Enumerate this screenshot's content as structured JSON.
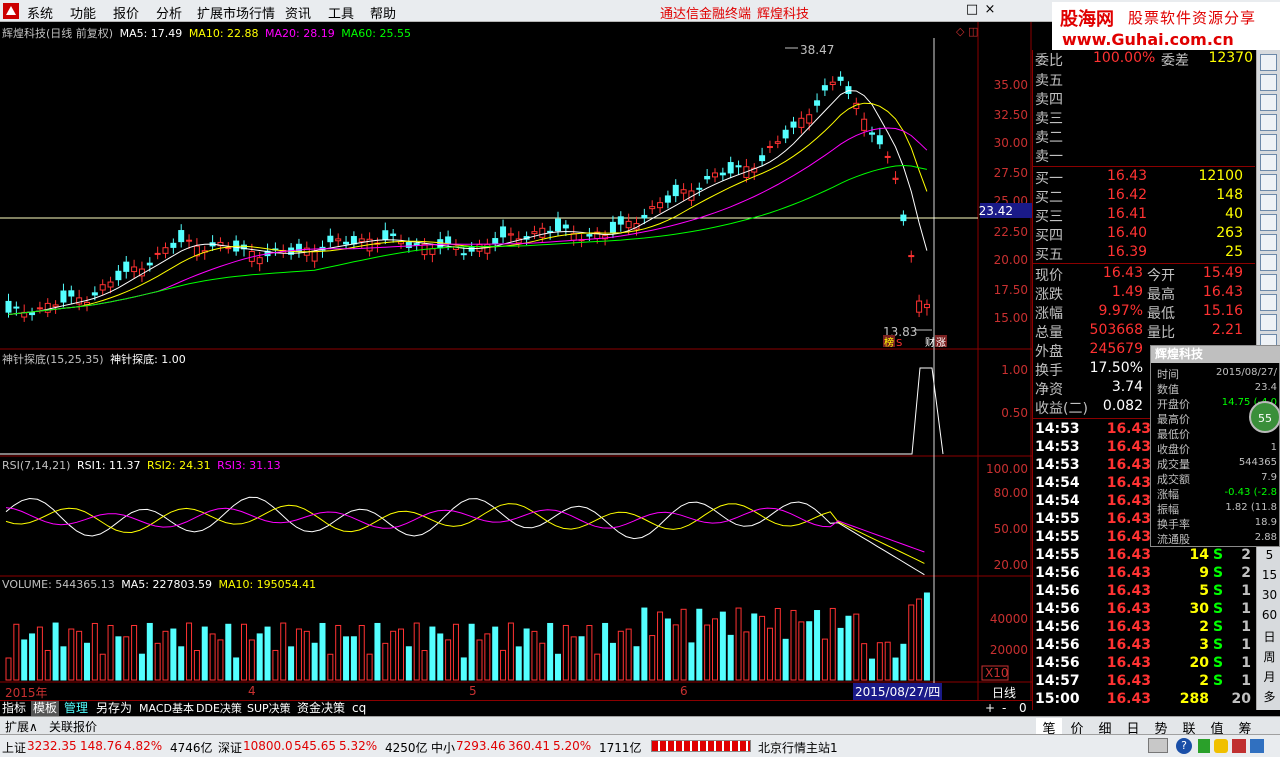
{
  "menu": {
    "items": [
      "系统",
      "功能",
      "报价",
      "分析",
      "扩展市场行情",
      "资讯",
      "工具",
      "帮助"
    ],
    "app_title": "通达信金融终端",
    "stock_title": "辉煌科技",
    "window_buttons": [
      "□",
      "×"
    ]
  },
  "banner": {
    "brand": "股海网",
    "tagline": "股票软件资源分享",
    "url": "www.Guhai.com.cn"
  },
  "main_chart": {
    "legend_title": "辉煌科技(日线 前复权)",
    "ma5": "MA5: 17.49",
    "ma10": "MA10: 22.88",
    "ma20": "MA20: 28.19",
    "ma60": "MA60: 25.55",
    "price_ticks": [
      "35.00",
      "32.50",
      "30.00",
      "27.50",
      "25.00",
      "22.50",
      "20.00",
      "17.50",
      "15.00"
    ],
    "current_price_tag": "23.42",
    "high_label": "38.47",
    "low_label": "13.83",
    "signal_labels": [
      "榜",
      "S",
      "财",
      "涨"
    ]
  },
  "indicator_panel": {
    "legend_name": "神针探底(15,25,35)",
    "legend_value": "神针探底: 1.00",
    "ticks": [
      "1.00",
      "0.50"
    ]
  },
  "rsi_panel": {
    "legend_name": "RSI(7,14,21)",
    "rsi1": "RSI1: 11.37",
    "rsi2": "RSI2: 24.31",
    "rsi3": "RSI3: 31.13",
    "ticks": [
      "100.00",
      "80.00",
      "50.00",
      "20.00"
    ]
  },
  "volume_panel": {
    "legend_volume": "VOLUME: 544365.13",
    "ma5": "MA5: 227803.59",
    "ma10": "MA10: 195054.41",
    "ticks": [
      "40000",
      "20000"
    ],
    "unit": "X10"
  },
  "time_axis": {
    "labels": [
      "2015年",
      "4",
      "5",
      "6"
    ],
    "cursor_date": "2015/08/27/四",
    "period": "日线"
  },
  "quote_panel": {
    "header_left": "委比",
    "header_mid": "100.00%",
    "header_right_label": "委差",
    "header_right_value": "12370",
    "asks": [
      {
        "label": "卖五",
        "price": "",
        "volume": ""
      },
      {
        "label": "卖四",
        "price": "",
        "volume": ""
      },
      {
        "label": "卖三",
        "price": "",
        "volume": ""
      },
      {
        "label": "卖二",
        "price": "",
        "volume": ""
      },
      {
        "label": "卖一",
        "price": "",
        "volume": ""
      }
    ],
    "bids": [
      {
        "label": "买一",
        "price": "16.43",
        "volume": "12100"
      },
      {
        "label": "买二",
        "price": "16.42",
        "volume": "148"
      },
      {
        "label": "买三",
        "price": "16.41",
        "volume": "40"
      },
      {
        "label": "买四",
        "price": "16.40",
        "volume": "263"
      },
      {
        "label": "买五",
        "price": "16.39",
        "volume": "25"
      }
    ],
    "stats": [
      {
        "l1": "现价",
        "v1": "16.43",
        "l2": "今开",
        "v2": "15.49"
      },
      {
        "l1": "涨跌",
        "v1": "1.49",
        "l2": "最高",
        "v2": "16.43"
      },
      {
        "l1": "涨幅",
        "v1": "9.97%",
        "l2": "最低",
        "v2": "15.16"
      },
      {
        "l1": "总量",
        "v1": "503668",
        "l2": "量比",
        "v2": "2.21"
      },
      {
        "l1": "外盘",
        "v1": "245679",
        "l2": "",
        "v2": ""
      },
      {
        "l1": "换手",
        "v1": "17.50%",
        "l2": "",
        "v2": ""
      },
      {
        "l1": "净资",
        "v1": "3.74",
        "l2": "",
        "v2": ""
      },
      {
        "l1": "收益(二)",
        "v1": "0.082",
        "l2": "",
        "v2": ""
      }
    ],
    "ticks": [
      {
        "time": "14:53",
        "price": "16.43",
        "vol": "",
        "bs": "",
        "n": ""
      },
      {
        "time": "14:53",
        "price": "16.43",
        "vol": "",
        "bs": "",
        "n": ""
      },
      {
        "time": "14:53",
        "price": "16.43",
        "vol": "",
        "bs": "",
        "n": ""
      },
      {
        "time": "14:54",
        "price": "16.43",
        "vol": "",
        "bs": "",
        "n": ""
      },
      {
        "time": "14:54",
        "price": "16.43",
        "vol": "",
        "bs": "",
        "n": ""
      },
      {
        "time": "14:55",
        "price": "16.43",
        "vol": "",
        "bs": "",
        "n": ""
      },
      {
        "time": "14:55",
        "price": "16.43",
        "vol": "",
        "bs": "",
        "n": ""
      },
      {
        "time": "14:55",
        "price": "16.43",
        "vol": "14",
        "bs": "S",
        "n": "2"
      },
      {
        "time": "14:56",
        "price": "16.43",
        "vol": "9",
        "bs": "S",
        "n": "2"
      },
      {
        "time": "14:56",
        "price": "16.43",
        "vol": "5",
        "bs": "S",
        "n": "1"
      },
      {
        "time": "14:56",
        "price": "16.43",
        "vol": "30",
        "bs": "S",
        "n": "1"
      },
      {
        "time": "14:56",
        "price": "16.43",
        "vol": "2",
        "bs": "S",
        "n": "1"
      },
      {
        "time": "14:56",
        "price": "16.43",
        "vol": "3",
        "bs": "S",
        "n": "1"
      },
      {
        "time": "14:56",
        "price": "16.43",
        "vol": "20",
        "bs": "S",
        "n": "1"
      },
      {
        "time": "14:57",
        "price": "16.43",
        "vol": "2",
        "bs": "S",
        "n": "1"
      },
      {
        "time": "15:00",
        "price": "16.43",
        "vol": "288",
        "bs": "",
        "n": "20"
      }
    ]
  },
  "popup": {
    "title": "辉煌科技",
    "rows": [
      {
        "label": "时间",
        "value": "2015/08/27/"
      },
      {
        "label": "数值",
        "value": "23.4"
      },
      {
        "label": "开盘价",
        "value": "14.75 (-4.0"
      },
      {
        "label": "最高价",
        "value": ""
      },
      {
        "label": "最低价",
        "value": ""
      },
      {
        "label": "收盘价",
        "value": "1"
      },
      {
        "label": "成交量",
        "value": "544365"
      },
      {
        "label": "成交额",
        "value": "7.9"
      },
      {
        "label": "涨幅",
        "value": "-0.43 (-2.8"
      },
      {
        "label": "振幅",
        "value": "1.82 (11.8"
      },
      {
        "label": "换手率",
        "value": "18.9"
      },
      {
        "label": "流通股",
        "value": "2.88"
      }
    ],
    "badge": "55"
  },
  "bottom_tabs": [
    "指标",
    "模板",
    "管理",
    "另存为",
    "MACD基本",
    "DDE决策",
    "SUP决策",
    "资金决策",
    "cq"
  ],
  "bottom_tabs2": [
    "扩展∧",
    "关联报价"
  ],
  "bottom_controls": [
    "+",
    "-",
    "0"
  ],
  "quote_tabs": [
    "笔",
    "价",
    "细",
    "日",
    "势",
    "联",
    "值",
    "筹"
  ],
  "right_bar": {
    "texts": [
      "5",
      "15",
      "30",
      "60",
      "日",
      "周",
      "月",
      "多"
    ]
  },
  "statusbar": {
    "sh_label": "上证",
    "sh_index": "3232.35",
    "sh_change": "148.76",
    "sh_pct": "4.82%",
    "sh_amount": "4746亿",
    "sz_label": "深证",
    "sz_index": "10800.0",
    "sz_change": "545.65",
    "sz_pct": "5.32%",
    "sz_amount": "4250亿",
    "zx_label": "中小",
    "zx_index": "7293.46",
    "zx_change": "360.41",
    "zx_pct": "5.20%",
    "zx_amount": "1711亿",
    "server": "北京行情主站1"
  },
  "colors": {
    "up": "#ff3232",
    "down": "#54ffff",
    "ma5": "#ffffff",
    "ma10": "#ffff00",
    "ma20": "#ff00ff",
    "ma60": "#00ff00",
    "border": "#8b0000"
  }
}
